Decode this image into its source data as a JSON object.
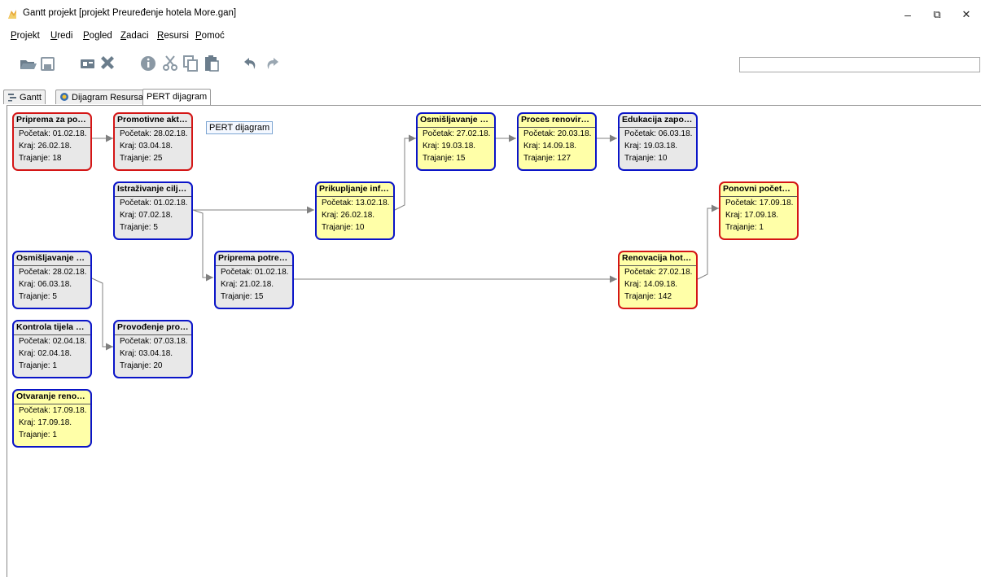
{
  "window": {
    "title": "Gantt projekt [projekt Preuređenje hotela More.gan]",
    "minimize_glyph": "–",
    "restore_glyph": "⧉",
    "close_glyph": "✕"
  },
  "menu": [
    "Projekt",
    "Uredi",
    "Pogled",
    "Zadaci",
    "Resursi",
    "Pomoć"
  ],
  "toolbar": {
    "icons": [
      "open-icon",
      "save-icon",
      "new-resource-icon",
      "delete-icon",
      "properties-icon",
      "cut-icon",
      "copy-icon",
      "paste-icon",
      "undo-icon",
      "redo-icon"
    ],
    "search_value": ""
  },
  "tabs": [
    "Gantt",
    "Dijagram Resursa",
    "PERT dijagram"
  ],
  "tooltip": "PERT dijagram",
  "labels": {
    "start": "Početak:",
    "end": "Kraj:",
    "duration": "Trajanje:"
  },
  "colors": {
    "critical_border": "#d41515",
    "normal_border": "#0a14c8",
    "yellow_fill": "#ffffa8",
    "gray_fill": "#e8e8e8",
    "link": "#808080"
  },
  "pert": {
    "nodes": [
      {
        "name": "Priprema za pokr...",
        "start": "01.02.18.",
        "end": "26.02.18.",
        "duration": "18",
        "critical": true,
        "fill": "gray"
      },
      {
        "name": "Promotivne aktiv...",
        "start": "28.02.18.",
        "end": "03.04.18.",
        "duration": "25",
        "critical": true,
        "fill": "gray"
      },
      {
        "name": "Istraživanje ciljni...",
        "start": "01.02.18.",
        "end": "07.02.18.",
        "duration": "5",
        "critical": false,
        "fill": "gray"
      },
      {
        "name": "Prikupljanje inf. o...",
        "start": "13.02.18.",
        "end": "26.02.18.",
        "duration": "10",
        "critical": false,
        "fill": "yellow"
      },
      {
        "name": "Osmišljavanje re...",
        "start": "27.02.18.",
        "end": "19.03.18.",
        "duration": "15",
        "critical": false,
        "fill": "yellow"
      },
      {
        "name": "Proces renoviran...",
        "start": "20.03.18.",
        "end": "14.09.18.",
        "duration": "127",
        "critical": false,
        "fill": "yellow"
      },
      {
        "name": "Edukacija zaposle...",
        "start": "06.03.18.",
        "end": "19.03.18.",
        "duration": "10",
        "critical": false,
        "fill": "gray"
      },
      {
        "name": "Ponovni početak...",
        "start": "17.09.18.",
        "end": "17.09.18.",
        "duration": "1",
        "critical": true,
        "fill": "yellow"
      },
      {
        "name": "Osmišljavanje pr...",
        "start": "28.02.18.",
        "end": "06.03.18.",
        "duration": "5",
        "critical": false,
        "fill": "gray"
      },
      {
        "name": "Priprema potreb...",
        "start": "01.02.18.",
        "end": "21.02.18.",
        "duration": "15",
        "critical": false,
        "fill": "gray"
      },
      {
        "name": "Renovacija hotela",
        "start": "27.02.18.",
        "end": "14.09.18.",
        "duration": "142",
        "critical": true,
        "fill": "yellow"
      },
      {
        "name": "Kontrola tijela pro...",
        "start": "02.04.18.",
        "end": "02.04.18.",
        "duration": "1",
        "critical": false,
        "fill": "gray"
      },
      {
        "name": "Provođenje prom...",
        "start": "07.03.18.",
        "end": "03.04.18.",
        "duration": "20",
        "critical": false,
        "fill": "gray"
      },
      {
        "name": "Otvaranje renovir...",
        "start": "17.09.18.",
        "end": "17.09.18.",
        "duration": "1",
        "critical": false,
        "fill": "yellow"
      }
    ]
  }
}
